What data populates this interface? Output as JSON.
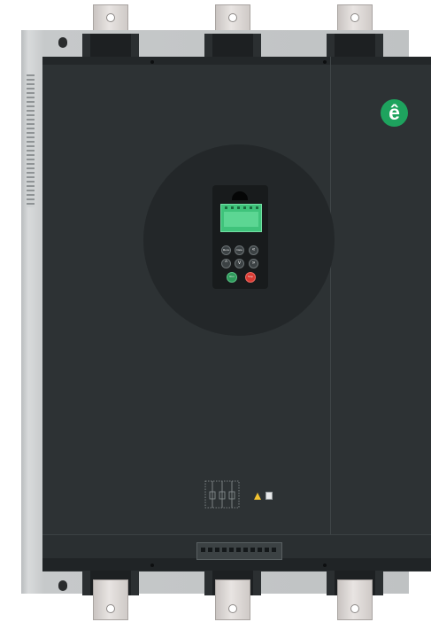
{
  "scene": {
    "description_type": "product-photo",
    "colors": {
      "panel": "#2d3234",
      "chassis": "#c6c9ca",
      "accent_green": "#1ea35e",
      "lcd": "#3fc37b",
      "run_button": "#2e9a5a",
      "stop_button": "#d93a32",
      "warning": "#f2c230"
    }
  },
  "logo": {
    "glyph": "ê",
    "icon": "brand-logo-icon"
  },
  "keypad": {
    "buttons_row1": [
      "Menu",
      "Data",
      "«"
    ],
    "buttons_row2": [
      "^",
      "v",
      "»"
    ],
    "run_label": "Run",
    "stop_label": "Stop Reset"
  }
}
